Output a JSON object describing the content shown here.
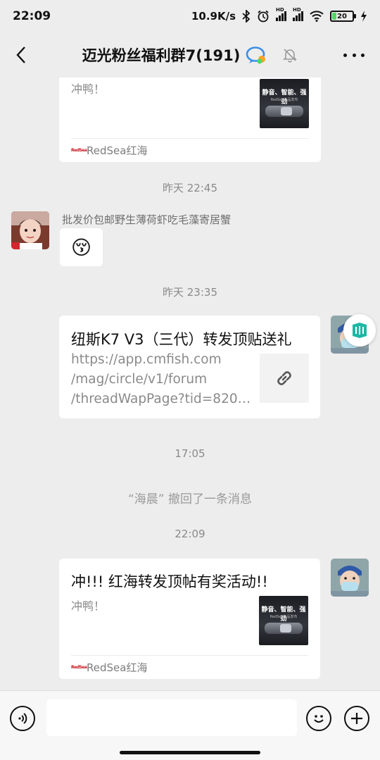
{
  "status": {
    "time": "22:09",
    "net_speed": "10.9K/s",
    "sim1_label": "HD",
    "sim2_label": "HD",
    "battery_percent": "20",
    "battery_level": 0.2
  },
  "nav": {
    "title": "迈光粉丝福利群7(191)"
  },
  "messages": {
    "top_card": {
      "desc": "冲鸭！",
      "source": "RedSea红海",
      "thumb_title": "静音、智能、强劲",
      "thumb_sub": "RedSea产品发布"
    },
    "time1": "昨天 22:45",
    "msg1": {
      "sender": "批发价包邮野生薄荷虾吃毛藻寄居蟹",
      "emoji": "😚"
    },
    "time2": "昨天 23:35",
    "link_card": {
      "title": "纽斯K7 V3（三代）转发顶贴送礼",
      "line1": "https://app.cmfish.com",
      "line2": "/mag/circle/v1/forum",
      "line3": "/threadWapPage?tid=820…"
    },
    "time3": "17:05",
    "recall_text": "“海晨” 撤回了一条消息",
    "time4": "22:09",
    "bottom_card": {
      "title": "冲!!! 红海转发顶帖有奖活动!!",
      "desc": "冲鸭！",
      "source": "RedSea红海",
      "thumb_title": "静音、智能、强劲",
      "thumb_sub": "RedSea产品发布"
    },
    "source_logo_text": "RedSea"
  },
  "icons": {
    "back": "back-arrow-icon",
    "more": "more-icon",
    "mute": "bell-mute-icon",
    "voice": "voice-icon",
    "emoji": "emoji-icon",
    "plus": "plus-icon",
    "link": "link-icon",
    "miniprogram": "mini-program-icon"
  },
  "colors": {
    "background": "#ededed",
    "card": "#ffffff",
    "miniprogram_accent": "#1cb8a3",
    "link_icon_bg": "#f2f2f2"
  }
}
